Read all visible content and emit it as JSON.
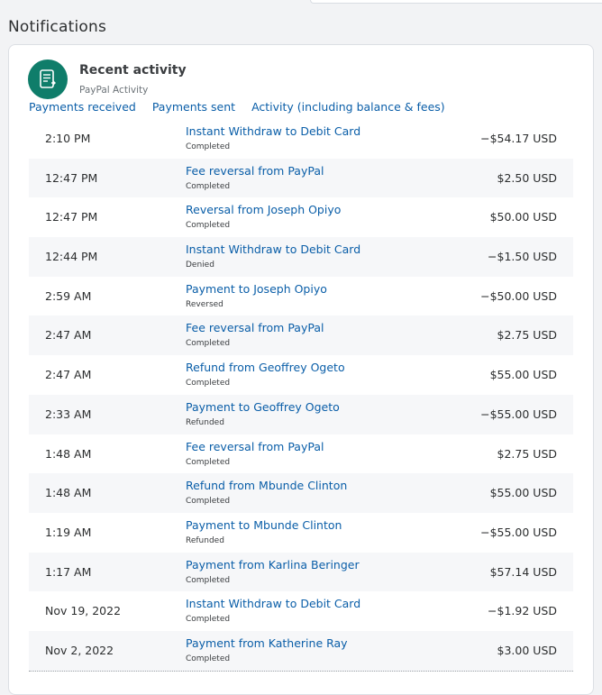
{
  "page": {
    "title": "Notifications"
  },
  "card": {
    "title": "Recent activity",
    "subtitle": "PayPal Activity",
    "logo_icon": "receipt-icon",
    "accent_color": "#0f7d6a"
  },
  "tabs": [
    {
      "label": "Payments received"
    },
    {
      "label": "Payments sent"
    },
    {
      "label": "Activity (including balance & fees)"
    }
  ],
  "transactions": [
    {
      "time": "2:10 PM",
      "description": "Instant Withdraw to Debit Card",
      "status": "Completed",
      "amount": "−$54.17 USD"
    },
    {
      "time": "12:47 PM",
      "description": "Fee reversal from PayPal",
      "status": "Completed",
      "amount": "$2.50 USD"
    },
    {
      "time": "12:47 PM",
      "description": "Reversal from Joseph Opiyo",
      "status": "Completed",
      "amount": "$50.00 USD"
    },
    {
      "time": "12:44 PM",
      "description": "Instant Withdraw to Debit Card",
      "status": "Denied",
      "amount": "−$1.50 USD"
    },
    {
      "time": "2:59 AM",
      "description": "Payment to Joseph Opiyo",
      "status": "Reversed",
      "amount": "−$50.00 USD"
    },
    {
      "time": "2:47 AM",
      "description": "Fee reversal from PayPal",
      "status": "Completed",
      "amount": "$2.75 USD"
    },
    {
      "time": "2:47 AM",
      "description": "Refund from Geoffrey Ogeto",
      "status": "Completed",
      "amount": "$55.00 USD"
    },
    {
      "time": "2:33 AM",
      "description": "Payment to Geoffrey Ogeto",
      "status": "Refunded",
      "amount": "−$55.00 USD"
    },
    {
      "time": "1:48 AM",
      "description": "Fee reversal from PayPal",
      "status": "Completed",
      "amount": "$2.75 USD"
    },
    {
      "time": "1:48 AM",
      "description": "Refund from Mbunde Clinton",
      "status": "Completed",
      "amount": "$55.00 USD"
    },
    {
      "time": "1:19 AM",
      "description": "Payment to Mbunde Clinton",
      "status": "Refunded",
      "amount": "−$55.00 USD"
    },
    {
      "time": "1:17 AM",
      "description": "Payment from Karlina Beringer",
      "status": "Completed",
      "amount": "$57.14 USD"
    },
    {
      "time": "Nov 19, 2022",
      "description": "Instant Withdraw to Debit Card",
      "status": "Completed",
      "amount": "−$1.92 USD"
    },
    {
      "time": "Nov 2, 2022",
      "description": "Payment from Katherine Ray",
      "status": "Completed",
      "amount": "$3.00 USD"
    }
  ]
}
